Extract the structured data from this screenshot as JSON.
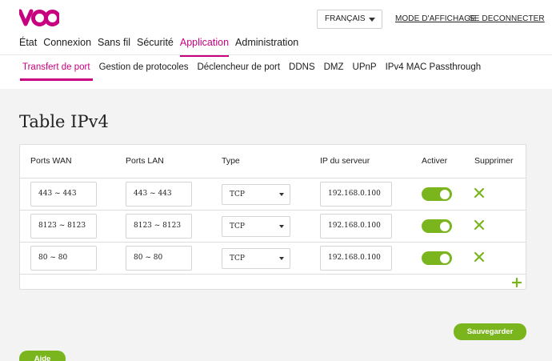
{
  "brand": {
    "accent": "#c8007f",
    "green": "#7ab51d"
  },
  "header": {
    "language": "FRANÇAIS",
    "display_mode": "MODE D'AFFICHAGE",
    "logout": "SE DECONNECTER"
  },
  "main_nav": [
    {
      "label": "État"
    },
    {
      "label": "Connexion"
    },
    {
      "label": "Sans fil"
    },
    {
      "label": "Sécurité"
    },
    {
      "label": "Application"
    },
    {
      "label": "Administration"
    }
  ],
  "main_nav_active": "Application",
  "sub_nav": [
    {
      "label": "Transfert de port"
    },
    {
      "label": "Gestion de protocoles"
    },
    {
      "label": "Déclencheur de port"
    },
    {
      "label": "DDNS"
    },
    {
      "label": "DMZ"
    },
    {
      "label": "UPnP"
    },
    {
      "label": "IPv4 MAC Passthrough"
    }
  ],
  "sub_nav_active": "Transfert de port",
  "section": {
    "title": "Table IPv4"
  },
  "table": {
    "headers": {
      "wan": "Ports WAN",
      "lan": "Ports LAN",
      "type": "Type",
      "ip": "IP du serveur",
      "enable": "Activer",
      "delete": "Supprimer"
    },
    "rows": [
      {
        "wan": "443 ~ 443",
        "lan": "443 ~ 443",
        "type": "TCP",
        "ip": "192.168.0.100",
        "enabled": true
      },
      {
        "wan": "8123 ~ 8123",
        "lan": "8123 ~ 8123",
        "type": "TCP",
        "ip": "192.168.0.100",
        "enabled": true
      },
      {
        "wan": "80 ~ 80",
        "lan": "80 ~ 80",
        "type": "TCP",
        "ip": "192.168.0.100",
        "enabled": true
      }
    ]
  },
  "buttons": {
    "save": "Sauvegarder",
    "help": "Aide"
  }
}
